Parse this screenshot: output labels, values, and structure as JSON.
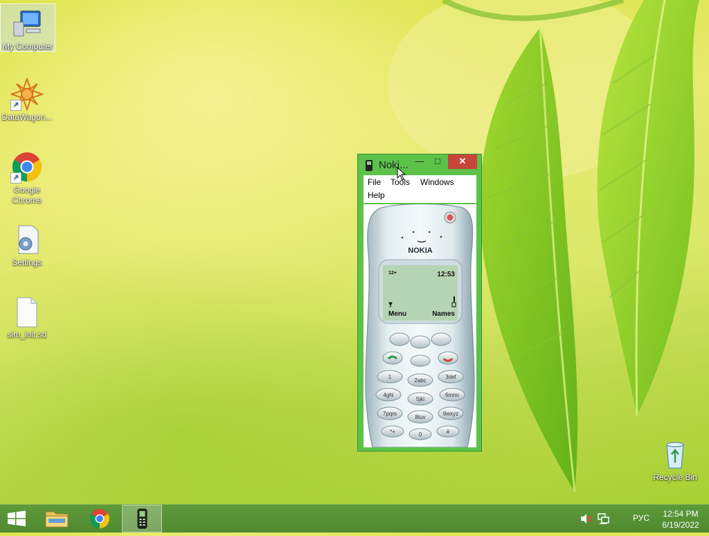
{
  "desktop": {
    "icons": [
      {
        "label": "My Computer"
      },
      {
        "label": "DataWagon..."
      },
      {
        "label": "Google Chrome"
      },
      {
        "label": "Settings"
      },
      {
        "label": "sim_init.sd"
      },
      {
        "label": "Recycle Bin"
      }
    ]
  },
  "window": {
    "title": "Noki...",
    "menu": [
      "File",
      "Tools",
      "Windows",
      "Help"
    ],
    "phone": {
      "brand": "NOKIA",
      "time": "12:53",
      "operator_glyph": "12+",
      "softkey_left": "Menu",
      "softkey_right": "Names",
      "keys": [
        "1",
        "2abc",
        "3def",
        "4ghi",
        "5jkl",
        "6mno",
        "7pqrs",
        "8tuv",
        "9wxyz",
        "*+",
        "0",
        "#"
      ]
    }
  },
  "taskbar": {
    "apps": [
      "start-button",
      "file-explorer",
      "google-chrome",
      "nokia-emulator"
    ],
    "language": "РУС",
    "time": "12:54 PM",
    "date": "6/19/2022"
  },
  "colors": {
    "window_frame": "#5cc24a",
    "close_button": "#c7453b",
    "taskbar": "#548f35",
    "phone_screen": "#b5d4b4"
  }
}
